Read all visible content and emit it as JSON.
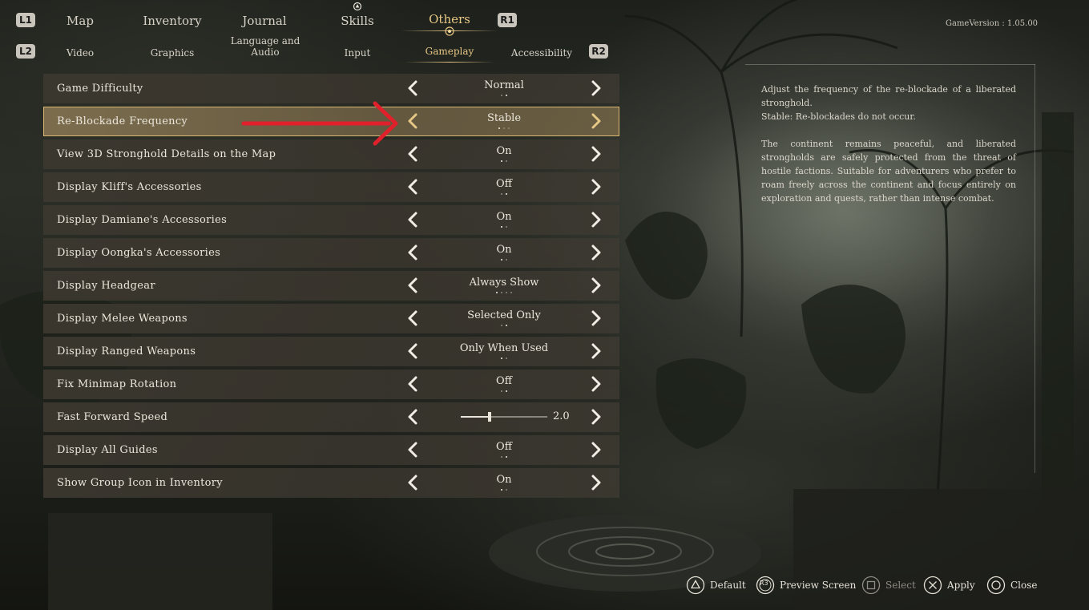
{
  "nav": {
    "shoulder_left_top": "L1",
    "shoulder_right_top": "R1",
    "shoulder_left_bottom": "L2",
    "shoulder_right_bottom": "R2",
    "tabs": [
      {
        "label": "Map"
      },
      {
        "label": "Inventory"
      },
      {
        "label": "Journal"
      },
      {
        "label": "Skills"
      },
      {
        "label": "Others"
      }
    ],
    "active_tab": "Others",
    "subtabs": [
      {
        "label": "Video"
      },
      {
        "label": "Graphics"
      },
      {
        "label": "Language and Audio"
      },
      {
        "label": "Input"
      },
      {
        "label": "Gameplay"
      },
      {
        "label": "Accessibility"
      }
    ],
    "active_subtab": "Gameplay"
  },
  "version": "GameVersion : 1.05.00",
  "settings": [
    {
      "label": "Game Difficulty",
      "value": "Normal",
      "option_count": 2,
      "selected_index": 1
    },
    {
      "label": "Re-Blockade Frequency",
      "value": "Stable",
      "option_count": 3,
      "selected_index": 0,
      "highlighted": true
    },
    {
      "label": "View 3D Stronghold Details on the Map",
      "value": "On",
      "option_count": 2,
      "selected_index": 0
    },
    {
      "label": "Display Kliff's Accessories",
      "value": "Off",
      "option_count": 2,
      "selected_index": 1
    },
    {
      "label": "Display Damiane's Accessories",
      "value": "On",
      "option_count": 2,
      "selected_index": 0
    },
    {
      "label": "Display Oongka's Accessories",
      "value": "On",
      "option_count": 2,
      "selected_index": 0
    },
    {
      "label": "Display Headgear",
      "value": "Always Show",
      "option_count": 4,
      "selected_index": 0
    },
    {
      "label": "Display Melee Weapons",
      "value": "Selected Only",
      "option_count": 2,
      "selected_index": 1
    },
    {
      "label": "Display Ranged Weapons",
      "value": "Only When Used",
      "option_count": 2,
      "selected_index": 0
    },
    {
      "label": "Fix Minimap Rotation",
      "value": "Off",
      "option_count": 2,
      "selected_index": 1
    },
    {
      "label": "Fast Forward Speed",
      "value": "2.0",
      "slider_fraction": 0.33
    },
    {
      "label": "Display All Guides",
      "value": "Off",
      "option_count": 2,
      "selected_index": 1
    },
    {
      "label": "Show Group Icon in Inventory",
      "value": "On",
      "option_count": 2,
      "selected_index": 0
    }
  ],
  "description": {
    "p1": "Adjust the frequency of the re-blockade of a liberated stronghold.",
    "p1b": "Stable: Re-blockades do not occur.",
    "p2": "The continent remains peaceful, and liberated strongholds are safely protected from the threat of hostile factions. Suitable for adventurers who prefer to roam freely across the continent and focus entirely on exploration and quests, rather than intense combat."
  },
  "footer": [
    {
      "label": "Default",
      "icon": "triangle-button-icon",
      "enabled": true
    },
    {
      "label": "Preview Screen",
      "icon": "r3-button-icon",
      "badge": "R3",
      "enabled": true
    },
    {
      "label": "Select",
      "icon": "square-button-icon",
      "enabled": false
    },
    {
      "label": "Apply",
      "icon": "cross-button-icon",
      "enabled": true
    },
    {
      "label": "Close",
      "icon": "circle-button-icon",
      "enabled": true
    }
  ],
  "colors": {
    "accent_gold": "#e7c785",
    "highlight_outline": "#d9b773",
    "annotation_red": "#e0202a"
  }
}
